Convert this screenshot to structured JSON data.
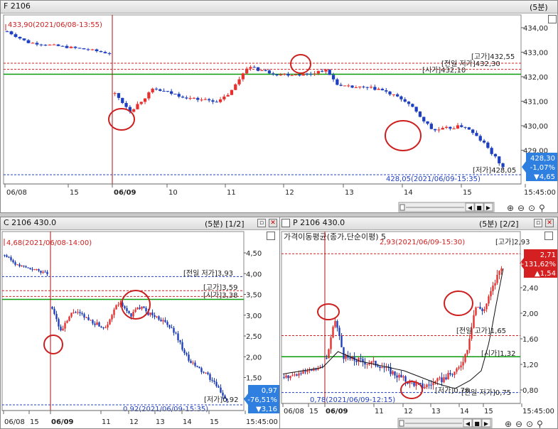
{
  "panels": {
    "f": {
      "title": "F 2106",
      "period": "(5분)",
      "price_labels": [
        "434,00",
        "433,00",
        "432,00",
        "431,00",
        "430,00",
        "429,00"
      ],
      "time_labels": [
        "06/08",
        "15",
        "06/09",
        "10",
        "11",
        "12",
        "13",
        "14",
        "15",
        "15:45:00"
      ],
      "annotations": {
        "high_note": "433,90(2021/06/08-13:55)",
        "low_note": "428,05(2021/06/09-15:35)",
        "gogа": "[고가]432,55",
        "prev_low": "[전일 저가]432,30",
        "open": "[시가]432,10",
        "low_tag": "[저가]428,05"
      },
      "badge": {
        "price": "428,30",
        "pct": "-1,07%",
        "chg": "▼4,65"
      }
    },
    "c": {
      "title": "C 2106 430.0",
      "period": "(5분) [1/2]",
      "price_labels": [
        "4,50",
        "4,00",
        "3,50",
        "3,00",
        "2,50",
        "2,00",
        "1,50",
        "1,00"
      ],
      "time_labels": [
        "06/08",
        "15",
        "06/09",
        "11",
        "12",
        "13",
        "14",
        "15",
        "15:45:00"
      ],
      "annotations": {
        "high_note": "4,68(2021/06/08-14:00)",
        "prev_low": "[전일 저가]3,93",
        "gogа": "[고가]3,59",
        "open": "[시가]3,38",
        "low_tag": "[저가]0,92",
        "low_note": "0,92(2021/06/09-15:35)"
      },
      "badge": {
        "price": "0,97",
        "pct": "-76,51%",
        "chg": "▼3,16"
      }
    },
    "p": {
      "title": "P 2106 430.0",
      "period": "(5분) [2/2]",
      "ma_label": "가격이동평균(종가,단순이평) 5",
      "price_labels": [
        "2,40",
        "2,00",
        "1,60",
        "1,20",
        "0,80"
      ],
      "time_labels": [
        "06/08",
        "15",
        "06/09",
        "11",
        "12",
        "13",
        "14",
        "15",
        "15:45:00"
      ],
      "annotations": {
        "high_note": "2,93(2021/06/09-15:30)",
        "high_tag": "[고가]2,93",
        "prev_high": "[전일 고가]1,65",
        "open": "[시가]1,32",
        "low_tag": "[저가]0,78",
        "prev_low": "[전일 저가]0,75",
        "low_note": "0,78(2021/06/09-12:15)"
      },
      "badge": {
        "price": "2,71",
        "pct": "+131,62%",
        "chg": "▲1,54"
      }
    }
  },
  "colors": {
    "up": "#e8312e",
    "down": "#1e3fbf",
    "support": "#0a9a0a",
    "ref": "#d02020",
    "badge_down": "#2f7fe0",
    "badge_up": "#d42020"
  }
}
